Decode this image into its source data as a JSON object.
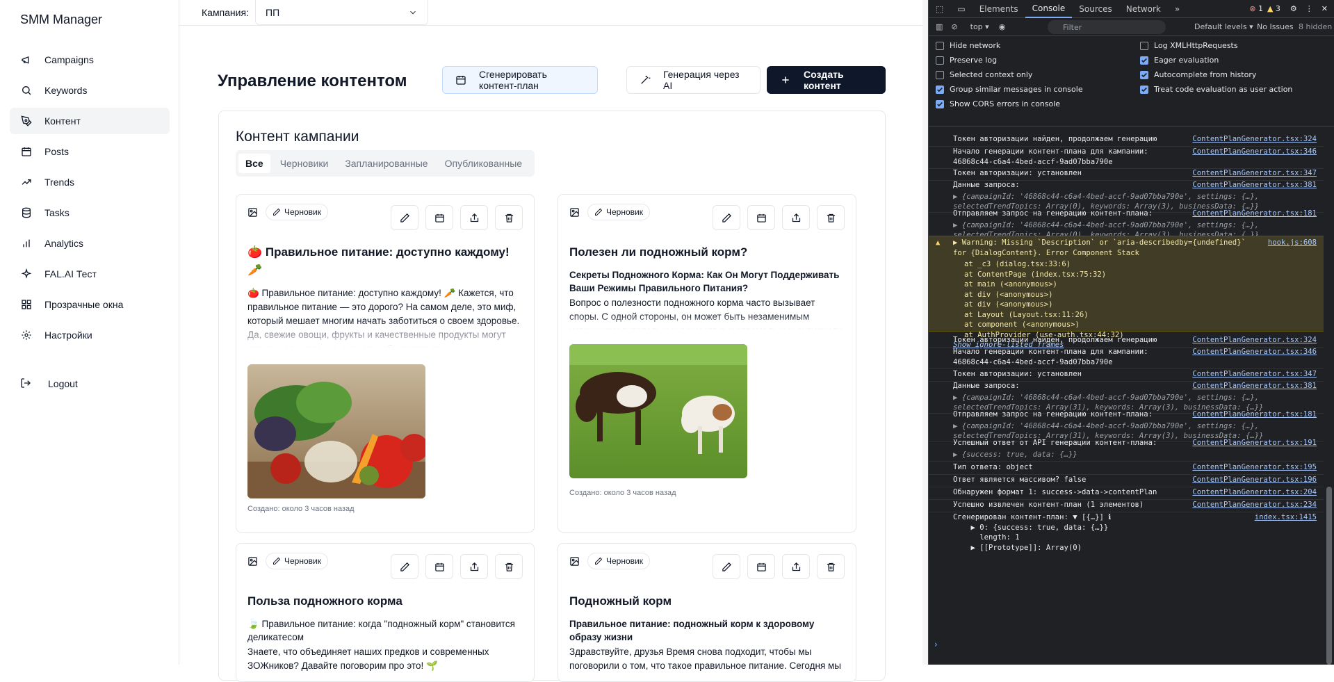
{
  "sidebar": {
    "brand": "SMM Manager",
    "items": [
      {
        "label": "Campaigns",
        "icon": "megaphone-icon",
        "active": false
      },
      {
        "label": "Keywords",
        "icon": "search-icon",
        "active": false
      },
      {
        "label": "Контент",
        "icon": "pen-tool-icon",
        "active": true
      },
      {
        "label": "Posts",
        "icon": "calendar-icon",
        "active": false
      },
      {
        "label": "Trends",
        "icon": "trending-up-icon",
        "active": false
      },
      {
        "label": "Tasks",
        "icon": "database-icon",
        "active": false
      },
      {
        "label": "Analytics",
        "icon": "bar-chart-icon",
        "active": false
      },
      {
        "label": "FAL.AI Тест",
        "icon": "sparkles-icon",
        "active": false
      },
      {
        "label": "Прозрачные окна",
        "icon": "grid-icon",
        "active": false
      },
      {
        "label": "Настройки",
        "icon": "gear-icon",
        "active": false
      }
    ],
    "logout": "Logout"
  },
  "topbar": {
    "campaign_label": "Кампания:",
    "campaign_value": "ПП"
  },
  "main": {
    "title": "Управление контентом",
    "buttons": {
      "generate_plan": "Сгенерировать контент-план",
      "ai_generate": "Генерация через AI",
      "create": "Создать контент"
    },
    "panel_title": "Контент кампании",
    "tabs": [
      "Все",
      "Черновики",
      "Запланированные",
      "Опубликованные"
    ],
    "cards": [
      {
        "badge": "Черновик",
        "title": "🍅 Правильное питание: доступно каждому! 🥕",
        "subtitle": "",
        "body": "🍅 Правильное питание: доступно каждому! 🥕 Кажется, что правильное питание — это дорого? На самом деле, это миф, который мешает многим начать заботиться о своем здоровье. Да, свежие овощи, фрукты и качественные продукты могут стоить недешево, но есть способы питаться",
        "created": "Создано: около 3 часов назад"
      },
      {
        "badge": "Черновик",
        "title": "Полезен ли подножный корм?",
        "subtitle": "Секреты Подножного Корма: Как Он Могут Поддерживать Ваши Режимы Правильного Питания?",
        "body": "Вопрос о полезности подножного корма часто вызывает споры. С одной стороны, он может быть незаменимым источником питательных веществ в экстремальных ситуациях",
        "created": "Создано: около 3 часов назад"
      },
      {
        "badge": "Черновик",
        "title": "Польза подножного корма",
        "subtitle": "🍃 Правильное питание: когда \"подножный корм\" становится деликатесом",
        "body": "Знаете, что объединяет наших предков и современных ЗОЖников? Давайте поговорим про это! 🌱",
        "created": ""
      },
      {
        "badge": "Черновик",
        "title": "Подножный корм",
        "subtitle": "Правильное питание: подножный корм к здоровому образу жизни",
        "body": "Здравствуйте, друзья Время снова подходит, чтобы мы поговорили о том, что такое правильное питание. Сегодня мы",
        "created": ""
      }
    ]
  },
  "devtools": {
    "tabs": [
      "Elements",
      "Console",
      "Sources",
      "Network"
    ],
    "active_tab": "Console",
    "errors": "1",
    "warnings": "3",
    "context": "top",
    "filter_placeholder": "Filter",
    "levels": "Default levels",
    "issues": "No Issues",
    "hidden": "8 hidden",
    "settings_left": [
      {
        "label": "Hide network",
        "checked": false
      },
      {
        "label": "Preserve log",
        "checked": false
      },
      {
        "label": "Selected context only",
        "checked": false
      },
      {
        "label": "Group similar messages in console",
        "checked": true
      },
      {
        "label": "Show CORS errors in console",
        "checked": true
      }
    ],
    "settings_right": [
      {
        "label": "Log XMLHttpRequests",
        "checked": false
      },
      {
        "label": "Eager evaluation",
        "checked": true
      },
      {
        "label": "Autocomplete from history",
        "checked": true
      },
      {
        "label": "Treat code evaluation as user action",
        "checked": true
      }
    ],
    "logs": [
      {
        "msg": "Токен авторизации найден, продолжаем генерацию",
        "src": "ContentPlanGenerator.tsx:324"
      },
      {
        "msg": "Начало генерации контент-плана для кампании:\n46868c44-c6a4-4bed-accf-9ad07bba790e",
        "src": "ContentPlanGenerator.tsx:346"
      },
      {
        "msg": "Токен авторизации: установлен",
        "src": "ContentPlanGenerator.tsx:347"
      },
      {
        "msg": "Данные запроса:",
        "obj": "▶ {campaignId: '46868c44-c6a4-4bed-accf-9ad07bba790e', settings: {…}, selectedTrendTopics: Array(0), keywords: Array(3), businessData: {…}}",
        "src": "ContentPlanGenerator.tsx:381"
      },
      {
        "msg": "Отправляем запрос на генерацию контент-плана:",
        "obj": "▶ {campaignId: '46868c44-c6a4-4bed-accf-9ad07bba790e', settings: {…}, selectedTrendTopics: Array(0), keywords: Array(3), businessData: {…}}",
        "src": "ContentPlanGenerator.tsx:181"
      },
      {
        "msg": "Токен авторизации найден, продолжаем генерацию",
        "src": "ContentPlanGenerator.tsx:324"
      },
      {
        "msg": "Начало генерации контент-плана для кампании:\n46868c44-c6a4-4bed-accf-9ad07bba790e",
        "src": "ContentPlanGenerator.tsx:346"
      },
      {
        "msg": "Токен авторизации: установлен",
        "src": "ContentPlanGenerator.tsx:347"
      },
      {
        "msg": "Данные запроса:",
        "obj": "▶ {campaignId: '46868c44-c6a4-4bed-accf-9ad07bba790e', settings: {…}, selectedTrendTopics: Array(31), keywords: Array(3), businessData: {…}}",
        "src": "ContentPlanGenerator.tsx:381"
      },
      {
        "msg": "Отправляем запрос на генерацию контент-плана:",
        "obj": "▶ {campaignId: '46868c44-c6a4-4bed-accf-9ad07bba790e', settings: {…}, selectedTrendTopics: Array(31), keywords: Array(3), businessData: {…}}",
        "src": "ContentPlanGenerator.tsx:181"
      },
      {
        "msg": "Успешный ответ от API генерации контент-плана:",
        "obj": "▶ {success: true, data: {…}}",
        "src": "ContentPlanGenerator.tsx:191"
      },
      {
        "msg": "Тип ответа: object",
        "src": "ContentPlanGenerator.tsx:195"
      },
      {
        "msg": "Ответ является массивом? false",
        "src": "ContentPlanGenerator.tsx:196"
      },
      {
        "msg": "Обнаружен формат 1: success->data->contentPlan",
        "src": "ContentPlanGenerator.tsx:204"
      },
      {
        "msg": "Успешно извлечен контент-план (1 элементов)",
        "src": "ContentPlanGenerator.tsx:234"
      },
      {
        "msg": "Сгенерирован контент-план: ▼ [{…}] ℹ\n    ▶ 0: {success: true, data: {…}}\n      length: 1\n    ▶ [[Prototype]]: Array(0)",
        "src": "index.tsx:1415"
      }
    ],
    "warning": {
      "text": "▶ Warning: Missing `Description` or `aria-describedby={undefined}` for {DialogContent}. Error Component Stack",
      "src": "hook.js:608",
      "stack": [
        "at _c3 (dialog.tsx:33:6)",
        "at ContentPage (index.tsx:75:32)",
        "at main (<anonymous>)",
        "at div (<anonymous>)",
        "at div (<anonymous>)",
        "at Layout (Layout.tsx:11:26)",
        "at component (<anonymous>)",
        "at AuthProvider (use-auth.tsx:44:32)"
      ],
      "more": "Show ignore-listed frames"
    }
  }
}
